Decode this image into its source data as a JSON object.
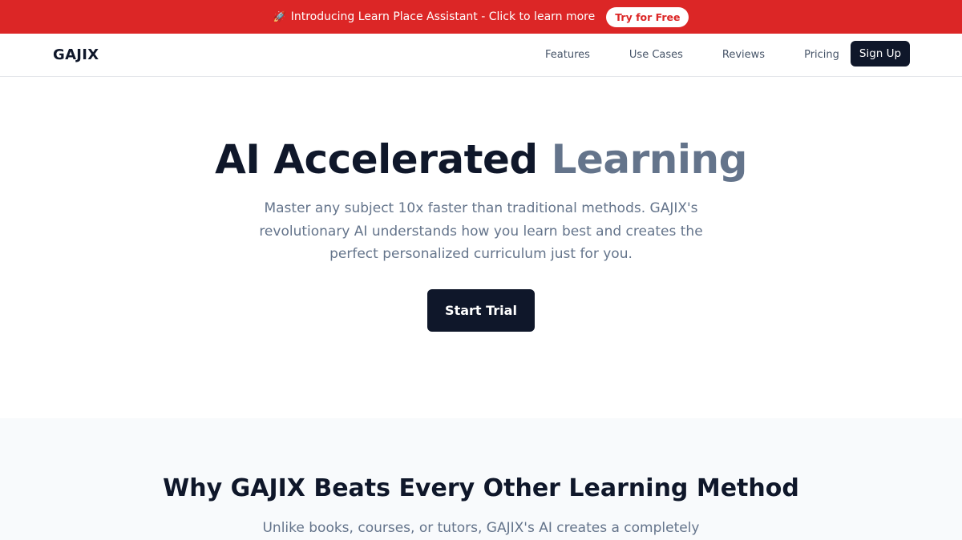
{
  "announcement": {
    "icon": "rocket-icon",
    "text": "Introducing Learn Place Assistant - Click to learn more",
    "cta_label": "Try for Free"
  },
  "nav": {
    "brand": "GAJIX",
    "links": [
      "Features",
      "Use Cases",
      "Reviews",
      "Pricing"
    ],
    "signup_label": "Sign Up"
  },
  "hero": {
    "title_main": "AI Accelerated",
    "title_accent": "Learning",
    "subtitle": "Master any subject 10x faster than traditional methods. GAJIX's revolutionary AI understands how you learn best and creates the perfect personalized curriculum just for you.",
    "cta_label": "Start Trial"
  },
  "why": {
    "title": "Why GAJIX Beats Every Other Learning Method",
    "text": "Unlike books, courses, or tutors, GAJIX's AI creates a completely"
  },
  "colors": {
    "announcement_bg": "#dc2626",
    "primary_dark": "#0f172a",
    "accent_gray": "#64748b",
    "section_bg": "#f8fafc"
  }
}
